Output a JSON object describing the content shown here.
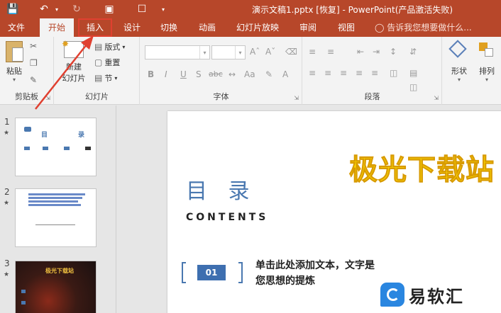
{
  "window": {
    "title": "演示文稿1.pptx [恢复] - PowerPoint(产品激活失败)"
  },
  "tabs": [
    {
      "label": "文件"
    },
    {
      "label": "开始"
    },
    {
      "label": "插入"
    },
    {
      "label": "设计"
    },
    {
      "label": "切换"
    },
    {
      "label": "动画"
    },
    {
      "label": "幻灯片放映"
    },
    {
      "label": "审阅"
    },
    {
      "label": "视图"
    }
  ],
  "tell_me": "告诉我您想要做什么...",
  "ribbon": {
    "clipboard": {
      "label": "剪贴板",
      "paste": "粘贴"
    },
    "slides": {
      "label": "幻灯片",
      "new_slide_line1": "新建",
      "new_slide_line2": "幻灯片",
      "layout": "版式",
      "reset": "重置",
      "section": "节"
    },
    "font": {
      "label": "字体",
      "bold": "B",
      "italic": "I",
      "underline": "U",
      "shadow": "S",
      "strike": "abc"
    },
    "paragraph": {
      "label": "段落"
    },
    "drawing": {
      "shapes": "形状",
      "arrange": "排列"
    }
  },
  "thumbnails": [
    {
      "number": "1",
      "mark": "★",
      "title_left": "目",
      "title_right": "录"
    },
    {
      "number": "2",
      "mark": "★"
    },
    {
      "number": "3",
      "mark": "★",
      "title": "极光下载站"
    }
  ],
  "slide": {
    "title": "目 录",
    "subtitle": "CONTENTS",
    "watermark": "极光下载站",
    "item_number": "01",
    "item_text_line1": "单击此处添加文本，文字是",
    "item_text_line2": "您思想的提炼"
  },
  "brand": {
    "name": "易软汇"
  },
  "colors": {
    "accent": "#b7472a",
    "slide_blue": "#4a78b0",
    "annotation_red": "#e04030"
  }
}
